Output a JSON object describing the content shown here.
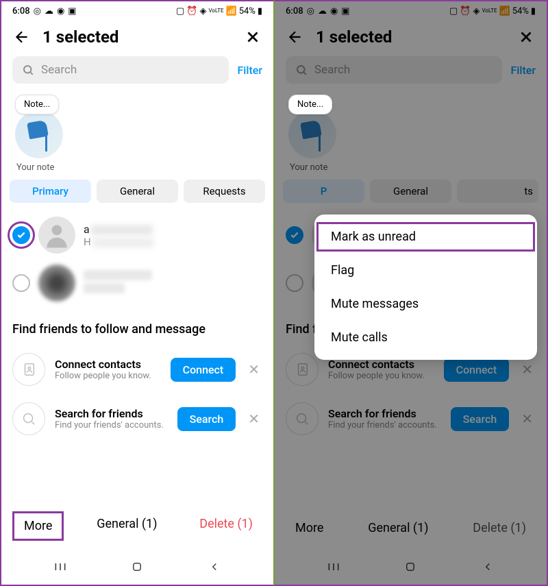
{
  "statusBar": {
    "time": "6:08",
    "battery": "54%"
  },
  "header": {
    "title": "1 selected"
  },
  "search": {
    "placeholder": "Search",
    "filterLabel": "Filter"
  },
  "note": {
    "bubble": "Note...",
    "label": "Your note"
  },
  "tabs": {
    "primary": "Primary",
    "general": "General",
    "requests": "Requests"
  },
  "conversations": [
    {
      "name": "a",
      "message": "H",
      "checked": true
    },
    {
      "name": "",
      "message": "",
      "checked": false
    }
  ],
  "findFriends": {
    "header": "Find friends to follow and message",
    "connectTitle": "Connect contacts",
    "connectSub": "Follow people you know.",
    "connectBtn": "Connect",
    "searchTitle": "Search for friends",
    "searchSub": "Find your friends' accounts.",
    "searchBtn": "Search"
  },
  "bottomActions": {
    "more": "More",
    "general": "General (1)",
    "delete": "Delete (1)"
  },
  "popup": {
    "markUnread": "Mark as unread",
    "flag": "Flag",
    "muteMessages": "Mute messages",
    "muteCalls": "Mute calls"
  }
}
